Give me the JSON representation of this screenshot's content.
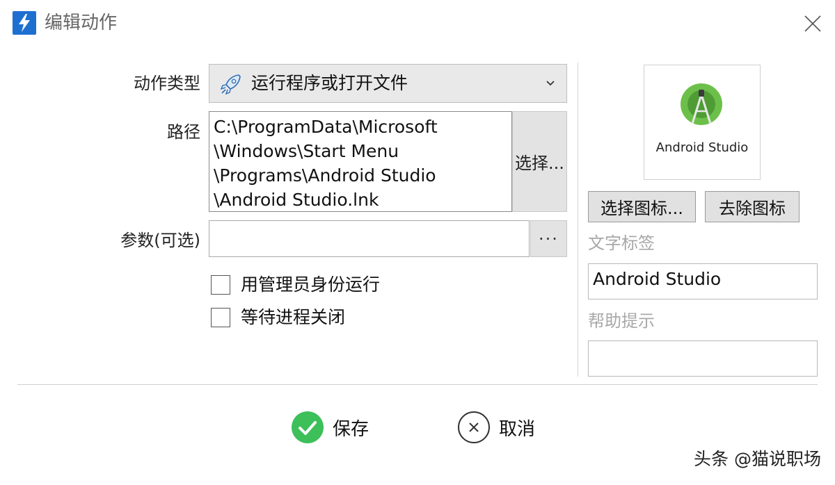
{
  "window": {
    "title": "编辑动作"
  },
  "form": {
    "action_type_label": "动作类型",
    "action_type_value": "运行程序或打开文件",
    "path_label": "路径",
    "path_lines": [
      "C:\\ProgramData\\Microsoft",
      "\\Windows\\Start Menu",
      "\\Programs\\Android Studio",
      "\\Android Studio.lnk"
    ],
    "choose_button": "选择...",
    "args_label": "参数(可选)",
    "args_value": "",
    "args_more_button": "···",
    "run_as_admin_label": "用管理员身份运行",
    "run_as_admin_checked": false,
    "wait_close_label": "等待进程关闭",
    "wait_close_checked": false
  },
  "side": {
    "icon_caption": "Android Studio",
    "choose_icon_button": "选择图标...",
    "remove_icon_button": "去除图标",
    "text_label_title": "文字标签",
    "text_label_value": "Android Studio",
    "help_tip_title": "帮助提示",
    "help_tip_value": ""
  },
  "footer": {
    "save_label": "保存",
    "cancel_label": "取消"
  },
  "watermark": "头条 @猫说职场",
  "colors": {
    "app_icon_bg": "#1f6fd1",
    "save_green": "#3dbf5a",
    "android_green": "#6cc04a"
  }
}
